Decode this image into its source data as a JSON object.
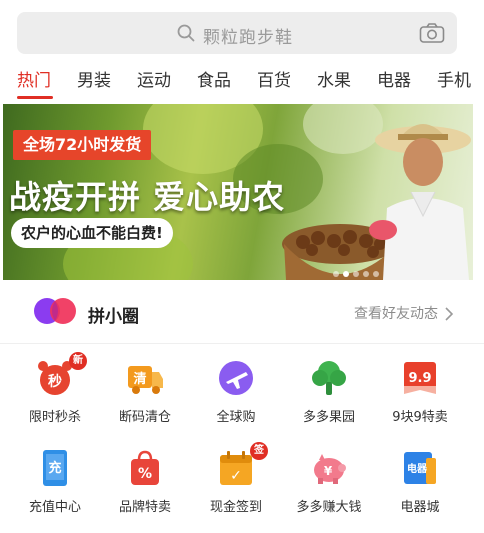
{
  "search": {
    "placeholder": "颗粒跑步鞋",
    "search_icon": "search-icon",
    "camera_icon": "camera-icon"
  },
  "categories": [
    "热门",
    "男装",
    "运动",
    "食品",
    "百货",
    "水果",
    "电器",
    "手机"
  ],
  "active_category": "热门",
  "banner": {
    "tag": "全场72小时发货",
    "headline": "战疫开拼 爱心助农",
    "subtag": "农户的心血不能白费!"
  },
  "circle": {
    "title": "拼小圈",
    "link": "查看好友动态"
  },
  "grid": [
    {
      "label": "限时秒杀",
      "icon": "alarm-clock-icon",
      "badge": "新",
      "glyph": "秒",
      "color": "#e6442f"
    },
    {
      "label": "断码清仓",
      "icon": "truck-icon",
      "glyph": "清",
      "color": "#f39a1e"
    },
    {
      "label": "全球购",
      "icon": "airplane-icon",
      "glyph": "✈",
      "color": "#8a5cf0"
    },
    {
      "label": "多多果园",
      "icon": "tree-icon",
      "glyph": "",
      "color": "#3fb34f"
    },
    {
      "label": "9块9特卖",
      "icon": "tag-icon",
      "glyph": "9.9",
      "color": "#e8402b"
    },
    {
      "label": "充值中心",
      "icon": "phone-icon",
      "glyph": "充",
      "color": "#2f8fe6"
    },
    {
      "label": "品牌特卖",
      "icon": "shopping-bag-icon",
      "glyph": "%",
      "color": "#e8453a"
    },
    {
      "label": "现金签到",
      "icon": "calendar-icon",
      "badge": "签",
      "glyph": "✓",
      "color": "#f5a623"
    },
    {
      "label": "多多赚大钱",
      "icon": "piggy-bank-icon",
      "glyph": "¥",
      "color": "#f27a8c"
    },
    {
      "label": "电器城",
      "icon": "appliance-icon",
      "glyph": "电器",
      "color": "#2d82e6"
    }
  ],
  "colors": {
    "accent": "#e02e24"
  }
}
